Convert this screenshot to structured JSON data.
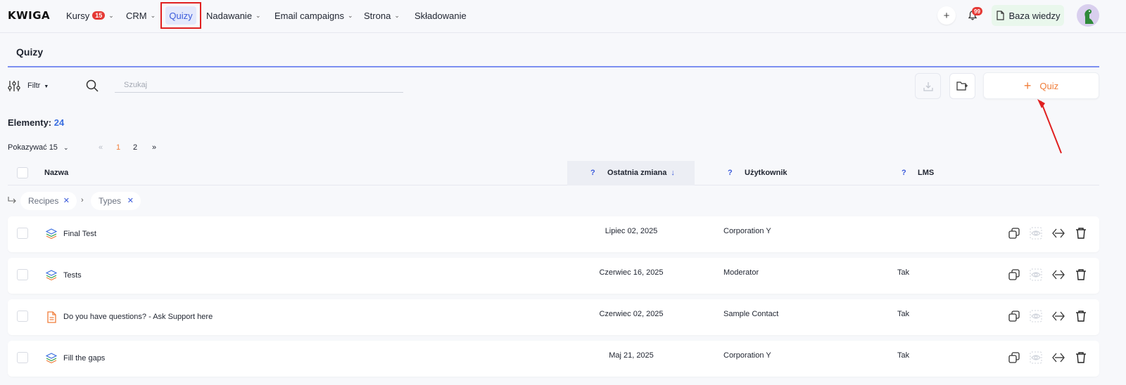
{
  "app": {
    "logo": "KWIGA"
  },
  "nav": {
    "items": [
      {
        "label": "Kursy",
        "badge": "15"
      },
      {
        "label": "CRM"
      },
      {
        "label": "Quizy"
      },
      {
        "label": "Nadawanie"
      },
      {
        "label": "Email campaigns"
      },
      {
        "label": "Strona"
      },
      {
        "label": "Składowanie"
      }
    ],
    "notifications_count": "99",
    "knowledge_base_label": "Baza wiedzy"
  },
  "page": {
    "title": "Quizy"
  },
  "toolbar": {
    "filter_label": "Filtr",
    "search_placeholder": "Szukaj",
    "add_button_label": "Quiz"
  },
  "summary": {
    "label": "Elementy:",
    "count": "24"
  },
  "pagination": {
    "per_page_label": "Pokazywać 15",
    "first": "«",
    "pages": [
      "1",
      "2"
    ],
    "last": "»",
    "current_page": "1"
  },
  "table": {
    "columns": {
      "name": "Nazwa",
      "last_change": "Ostatnia zmiana",
      "user": "Użytkownik",
      "lms": "LMS",
      "help": "?"
    },
    "sort_indicator": "↓",
    "breadcrumb": [
      "Recipes",
      "Types"
    ],
    "rows": [
      {
        "icon": "layers-icon",
        "name": "Final Test",
        "date": "Lipiec 02, 2025",
        "user": "Corporation Y",
        "lms": ""
      },
      {
        "icon": "layers-icon",
        "name": "Tests",
        "date": "Czerwiec 16, 2025",
        "user": "Moderator",
        "lms": "Tak"
      },
      {
        "icon": "document-icon",
        "name": "Do you have questions? - Ask Support here",
        "date": "Czerwiec 02, 2025",
        "user": "Sample Contact",
        "lms": "Tak"
      },
      {
        "icon": "layers-icon",
        "name": "Fill the gaps",
        "date": "Maj 21, 2025",
        "user": "Corporation Y",
        "lms": "Tak"
      }
    ]
  },
  "colors": {
    "accent_blue": "#3b5bdb",
    "accent_orange": "#f07d3a",
    "highlight_red": "#e02020",
    "badge_red": "#e53935"
  }
}
